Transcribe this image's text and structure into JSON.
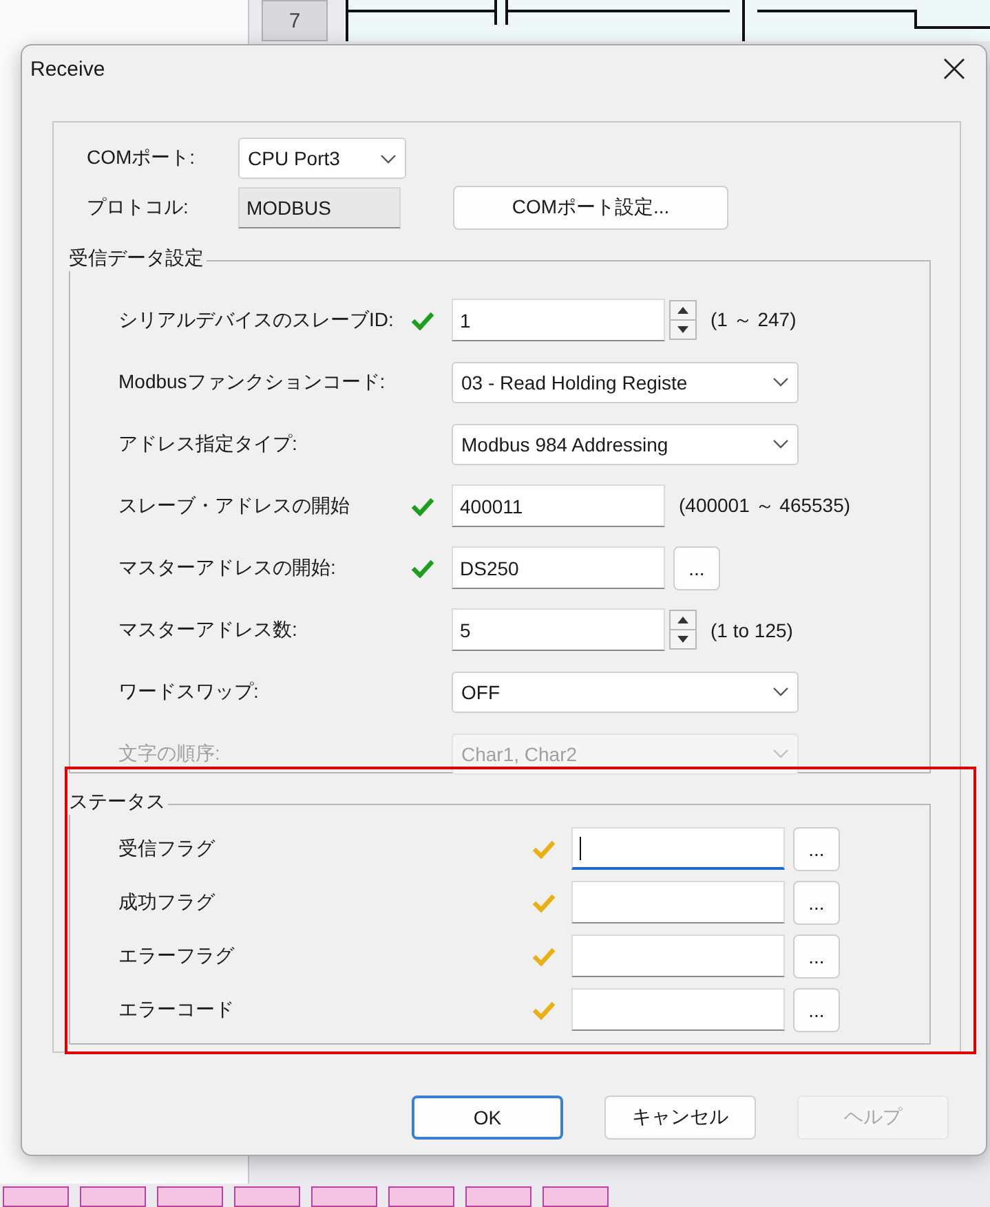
{
  "background": {
    "row_number": "7"
  },
  "window": {
    "title": "Receive"
  },
  "com_port": {
    "label": "COMポート:",
    "value": "CPU Port3"
  },
  "protocol": {
    "label": "プロトコル:",
    "value": "MODBUS"
  },
  "com_settings_button": "COMポート設定...",
  "receive_group": {
    "title": "受信データ設定",
    "rows": [
      {
        "kind": "spin",
        "label": "シリアルデバイスのスレーブID:",
        "valid": true,
        "value": "1",
        "note": "(1 ～ 247)"
      },
      {
        "kind": "select",
        "label": "Modbusファンクションコード:",
        "value": "03 - Read Holding Registe",
        "disabled": false
      },
      {
        "kind": "select",
        "label": "アドレス指定タイプ:",
        "value": "Modbus 984 Addressing",
        "disabled": false
      },
      {
        "kind": "text",
        "label": "スレーブ・アドレスの開始",
        "valid": true,
        "value": "400011",
        "note": "(400001 ～ 465535)"
      },
      {
        "kind": "browse",
        "label": "マスターアドレスの開始:",
        "valid": true,
        "value": "DS250",
        "button": "..."
      },
      {
        "kind": "spin",
        "label": "マスターアドレス数:",
        "value": "5",
        "note": "(1 to 125)"
      },
      {
        "kind": "select",
        "label": "ワードスワップ:",
        "value": "OFF",
        "disabled": false
      },
      {
        "kind": "select",
        "label": "文字の順序:",
        "value": "Char1, Char2",
        "disabled": true
      }
    ]
  },
  "status_group": {
    "title": "ステータス",
    "highlighted": true,
    "rows": [
      {
        "label": "受信フラグ",
        "valid": false,
        "focused": true,
        "button": "..."
      },
      {
        "label": "成功フラグ",
        "valid": false,
        "focused": false,
        "button": "..."
      },
      {
        "label": "エラーフラグ",
        "valid": false,
        "focused": false,
        "button": "..."
      },
      {
        "label": "エラーコード",
        "valid": false,
        "focused": false,
        "button": "..."
      }
    ]
  },
  "buttons": [
    {
      "label": "OK",
      "default": true,
      "disabled": false
    },
    {
      "label": "キャンセル",
      "default": false,
      "disabled": false
    },
    {
      "label": "ヘルプ",
      "default": false,
      "disabled": true
    }
  ]
}
